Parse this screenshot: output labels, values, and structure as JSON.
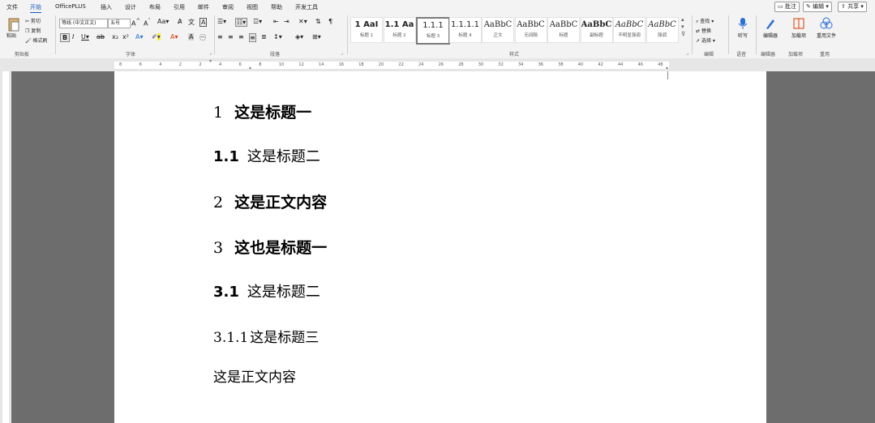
{
  "tabs": [
    "文件",
    "开始",
    "OfficePLUS",
    "插入",
    "设计",
    "布局",
    "引用",
    "邮件",
    "审阅",
    "视图",
    "帮助",
    "开发工具"
  ],
  "active_tab": "开始",
  "top_buttons": {
    "comments": "批注",
    "editing": "编辑",
    "share": "共享"
  },
  "clipboard": {
    "paste": "粘贴",
    "cut": "剪切",
    "copy": "复制",
    "format_painter": "格式刷",
    "label": "剪贴板"
  },
  "font": {
    "name": "等线 (中文正文)",
    "size": "五号",
    "label": "字体"
  },
  "paragraph": {
    "label": "段落"
  },
  "styles": {
    "label": "样式",
    "items": [
      {
        "sample": "1  AaI",
        "name": "标题 1",
        "bold": true
      },
      {
        "sample": "1.1  Aa",
        "name": "标题 2",
        "bold": true
      },
      {
        "sample": "1.1.1",
        "name": "标题 3",
        "bold": false
      },
      {
        "sample": "1.1.1.1",
        "name": "标题 4",
        "bold": false
      },
      {
        "sample": "AaBbC",
        "name": "正文",
        "bold": false
      },
      {
        "sample": "AaBbC",
        "name": "无间隔",
        "bold": false
      },
      {
        "sample": "AaBbC",
        "name": "标题",
        "bold": false
      },
      {
        "sample": "AaBbC",
        "name": "副标题",
        "bold": true
      },
      {
        "sample": "AaBbC",
        "name": "不明显强调",
        "bold": false
      },
      {
        "sample": "AaBbC",
        "name": "强调",
        "bold": false
      }
    ]
  },
  "editing": {
    "find": "查找",
    "replace": "替换",
    "select": "选择",
    "label": "编辑"
  },
  "voice": {
    "dictate": "听写",
    "label": "语音"
  },
  "addins": {
    "editor": "编辑器",
    "label": "编辑器"
  },
  "addin2": {
    "name": "加载项",
    "label": "加载项"
  },
  "addin3": {
    "name": "重用文件",
    "label": "重用"
  },
  "ruler_numbers": [
    "8",
    "6",
    "4",
    "2",
    "2",
    "4",
    "6",
    "8",
    "10",
    "12",
    "14",
    "16",
    "18",
    "20",
    "22",
    "24",
    "26",
    "28",
    "30",
    "32",
    "34",
    "36",
    "38",
    "40",
    "42",
    "44",
    "46",
    "48"
  ],
  "document": {
    "lines": [
      {
        "type": "h1",
        "num": "1",
        "text": "这是标题一"
      },
      {
        "type": "h2",
        "num": "1.1",
        "text": "这是标题二"
      },
      {
        "type": "h1",
        "num": "2",
        "text": "这是正文内容"
      },
      {
        "type": "h1",
        "num": "3",
        "text": "这也是标题一"
      },
      {
        "type": "h2",
        "num": "3.1",
        "text": "这是标题二"
      },
      {
        "type": "h3",
        "num": "3.1.1",
        "text": "这是标题三"
      },
      {
        "type": "body",
        "num": "",
        "text": "这是正文内容"
      }
    ]
  }
}
